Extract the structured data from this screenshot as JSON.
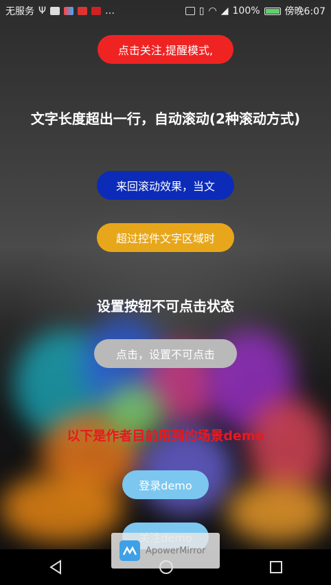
{
  "status_bar": {
    "carrier": "无服务",
    "battery_percent": "100%",
    "time": "傍晚6:07",
    "more_symbol": "…"
  },
  "buttons": {
    "follow_reminder": "点击关注,提醒模式,",
    "marquee_back_forth": "来回滚动效果，当文",
    "marquee_overflow": "超过控件文字区域时",
    "disabled_click": "点击，设置不可点击",
    "login_demo": "登录demo",
    "follow_demo": "关注demo"
  },
  "headings": {
    "marquee_title": "文字长度超出一行，自动滚动(2种滚动方式)",
    "disabled_title": "设置按钮不可点击状态",
    "demo_title": "以下是作者目前用到的场景demo"
  },
  "overlay": {
    "label": "ApowerMirror"
  },
  "colors": {
    "red_button": "#f02323",
    "blue_button": "#0b2bb8",
    "yellow_button": "#e8a61a",
    "gray_button": "#b9b9b9",
    "light_blue_button": "#7cc7ef",
    "demo_title_text": "#e8191e"
  }
}
